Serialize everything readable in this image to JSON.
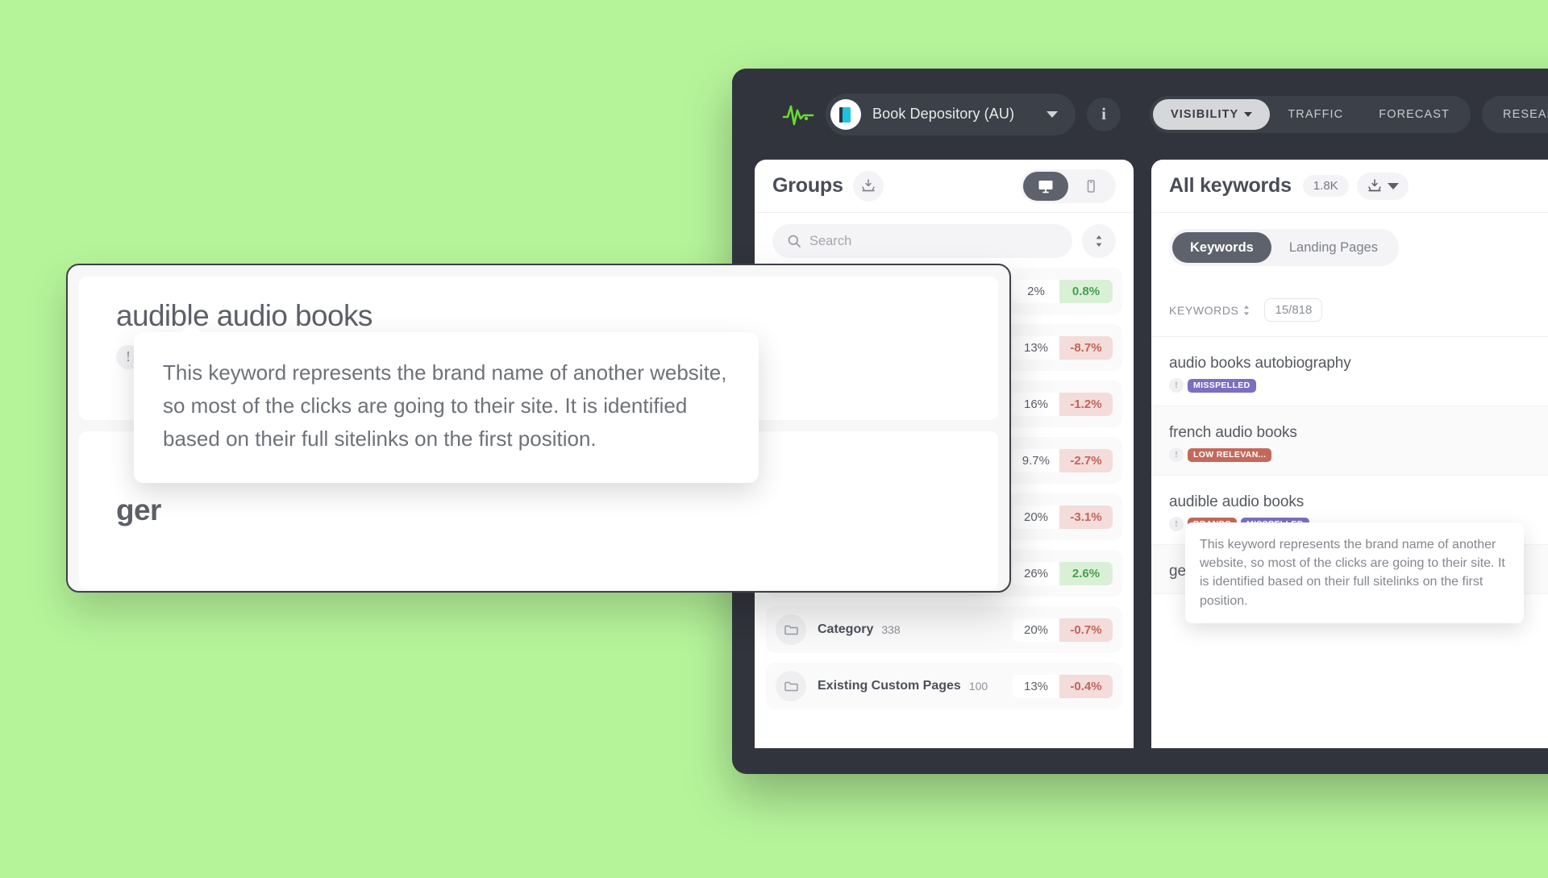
{
  "topbar": {
    "logo_icon": "pulse-line-icon",
    "project": {
      "avatar_icon": "book-icon",
      "name": "Book Depository (AU)",
      "caret_icon": "chevron-down-icon"
    },
    "info_button": "i",
    "tabs": [
      {
        "label": "VISIBILITY",
        "active": true,
        "has_caret": true
      },
      {
        "label": "TRAFFIC",
        "active": false,
        "has_caret": false
      },
      {
        "label": "FORECAST",
        "active": false,
        "has_caret": false
      }
    ],
    "tabs_secondary": [
      {
        "label": "RESEARCH",
        "active": false,
        "has_caret": false
      }
    ]
  },
  "groups_panel": {
    "title": "Groups",
    "export_icon": "download-tray-icon",
    "device_toggle": {
      "desktop_icon": "desktop-monitor-icon",
      "mobile_icon": "mobile-phone-icon",
      "active": "desktop"
    },
    "search": {
      "placeholder": "Search",
      "icon": "search-icon",
      "sort_icon": "sort-updown-icon"
    },
    "rows": [
      {
        "name": "",
        "count": "",
        "share": "2%",
        "delta": "0.8%",
        "dir": "up"
      },
      {
        "name": "",
        "count": "",
        "share": "13%",
        "delta": "-8.7%",
        "dir": "down"
      },
      {
        "name": "",
        "count": "",
        "share": "16%",
        "delta": "-1.2%",
        "dir": "down"
      },
      {
        "name": "",
        "count": "",
        "share": "9.7%",
        "delta": "-2.7%",
        "dir": "down"
      },
      {
        "name": "",
        "count": "",
        "share": "20%",
        "delta": "-3.1%",
        "dir": "down"
      },
      {
        "name": "",
        "count": "",
        "share": "26%",
        "delta": "2.6%",
        "dir": "up"
      },
      {
        "name": "Category",
        "count": "338",
        "share": "20%",
        "delta": "-0.7%",
        "dir": "down"
      },
      {
        "name": "Existing Custom Pages",
        "count": "100",
        "share": "13%",
        "delta": "-0.4%",
        "dir": "down"
      }
    ]
  },
  "keywords_panel": {
    "title": "All keywords",
    "count_chip": "1.8K",
    "export_icon": "download-tray-icon",
    "export_caret_icon": "chevron-down-icon",
    "tabs": [
      {
        "label": "Keywords",
        "active": true
      },
      {
        "label": "Landing Pages",
        "active": false
      }
    ],
    "column_header": {
      "label": "KEYWORDS",
      "sort_icon": "sort-updown-icon",
      "fraction": "15/818"
    },
    "rows": [
      {
        "keyword": "audio books autobiography",
        "info_icon": "info-circle-icon",
        "tags": [
          {
            "label": "MISSPELLED",
            "color": "#7b6fc0"
          }
        ]
      },
      {
        "keyword": "french audio books",
        "info_icon": "info-circle-icon",
        "tags": [
          {
            "label": "LOW RELEVAN...",
            "color": "#c4695a"
          }
        ]
      },
      {
        "keyword": "audible audio books",
        "info_icon": "info-circle-icon",
        "tags": [
          {
            "label": "BRANDS",
            "color": "#c4695a"
          },
          {
            "label": "MISSPELLED",
            "color": "#7b6fc0"
          }
        ]
      },
      {
        "keyword": "ger",
        "info_icon": "info-circle-icon",
        "tags": []
      }
    ],
    "tooltip": "This keyword represents the brand name of another website, so most of the clicks are going to their site. It is identified based on their full sitelinks on the first position."
  },
  "zoom_overlay": {
    "keyword": "audible audio books",
    "info_icon": "info-circle-icon",
    "tags": [
      {
        "label": "BRANDS",
        "color": "#c4695a"
      },
      {
        "label": "MISSPELLED",
        "color": "#7b6fc0"
      }
    ],
    "second_keyword": "ger",
    "tooltip": "This keyword represents the brand name of another website, so most of the clicks are going to their site. It is identified based on their full sitelinks on the first position."
  },
  "colors": {
    "background": "#b6f49a",
    "window_chrome": "#31343c",
    "accent_dark": "#5e626d",
    "brand_tag": "#c4695a",
    "misspelled_tag": "#7b6fc0",
    "delta_up_bg": "#d9f0d6",
    "delta_up_fg": "#4a9c52",
    "delta_down_bg": "#f3dcda",
    "delta_down_fg": "#c0655c"
  }
}
